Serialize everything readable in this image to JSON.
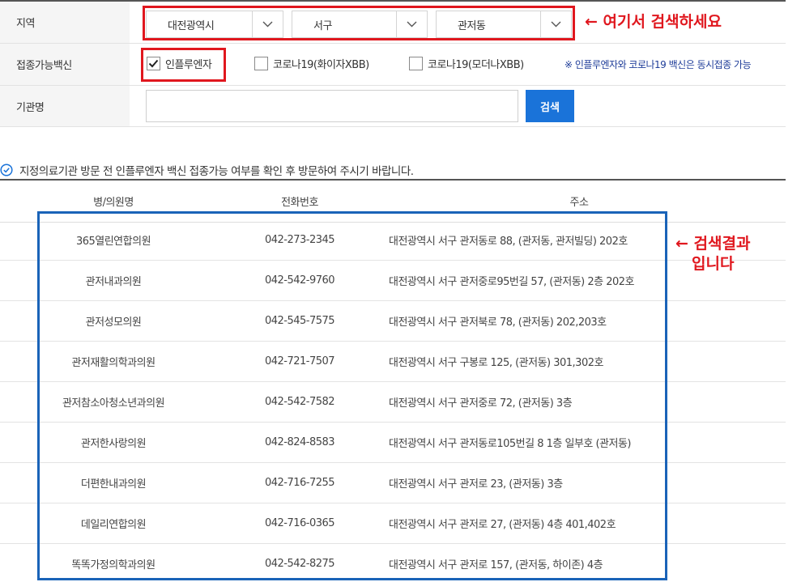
{
  "filters": {
    "region_label": "지역",
    "region_values": [
      "대전광역시",
      "서구",
      "관저동"
    ],
    "vaccine_label": "접종가능백신",
    "vaccines": [
      {
        "label": "인플루엔자",
        "checked": true
      },
      {
        "label": "코로나19(화이자XBB)",
        "checked": false
      },
      {
        "label": "코로나19(모더나XBB)",
        "checked": false
      }
    ],
    "vaccine_note": "※ 인플루엔자와 코로나19 백신은 동시접종 가능",
    "institution_label": "기관명",
    "institution_value": "",
    "search_button": "검색"
  },
  "annotations": {
    "search_hint": "← 여기서 검색하세요",
    "result_hint_line1": "← 검색결과",
    "result_hint_line2": "입니다",
    "highlight_red": "#e0171e",
    "highlight_blue": "#1a63b8"
  },
  "notice": "지정의료기관 방문 전 인플루엔자 백신 접종가능 여부를 확인 후 방문하여 주시기 바랍니다.",
  "table": {
    "headers": [
      "병/의원명",
      "전화번호",
      "주소"
    ],
    "rows": [
      [
        "365열린연합의원",
        "042-273-2345",
        "대전광역시 서구 관저동로 88, (관저동, 관저빌딩) 202호"
      ],
      [
        "관저내과의원",
        "042-542-9760",
        "대전광역시 서구 관저중로95번길 57, (관저동) 2층 202호"
      ],
      [
        "관저성모의원",
        "042-545-7575",
        "대전광역시 서구 관저북로 78, (관저동) 202,203호"
      ],
      [
        "관저재활의학과의원",
        "042-721-7507",
        "대전광역시 서구 구봉로 125, (관저동) 301,302호"
      ],
      [
        "관저참소아청소년과의원",
        "042-542-7582",
        "대전광역시 서구 관저중로 72, (관저동) 3층"
      ],
      [
        "관저한사랑의원",
        "042-824-8583",
        "대전광역시 서구 관저동로105번길 8 1층 일부호 (관저동)"
      ],
      [
        "더편한내과의원",
        "042-716-7255",
        "대전광역시 서구 관저로 23, (관저동) 3층"
      ],
      [
        "데일리연합의원",
        "042-716-0365",
        "대전광역시 서구 관저로 27, (관저동) 4층 401,402호"
      ],
      [
        "똑똑가정의학과의원",
        "042-542-8275",
        "대전광역시 서구 관저로 157, (관저동, 하이존) 4층"
      ]
    ]
  }
}
